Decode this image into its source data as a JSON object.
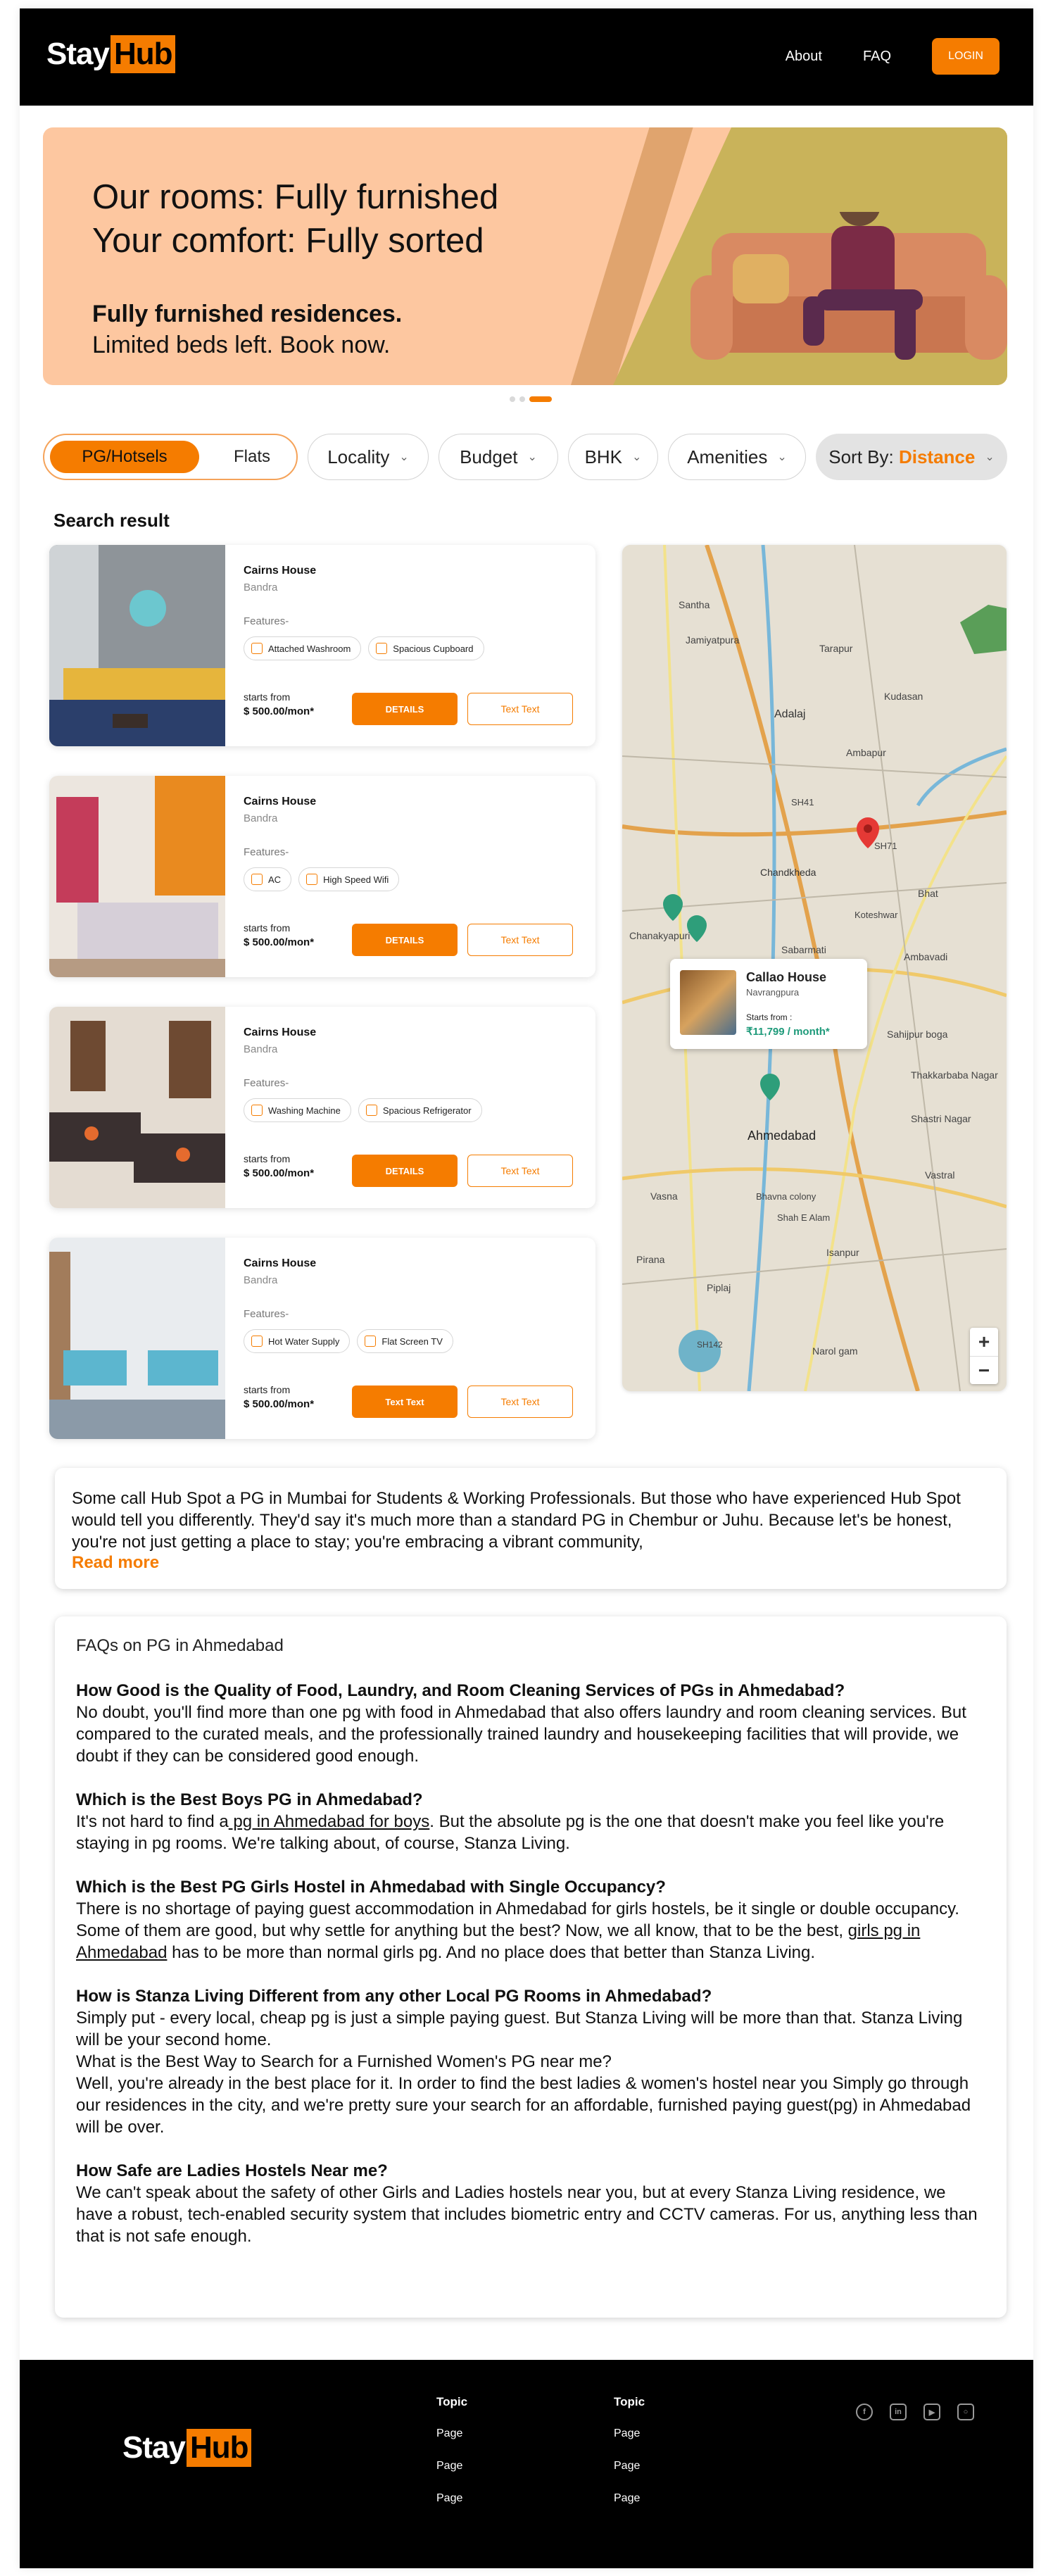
{
  "header": {
    "logo_stay": "Stay",
    "logo_hub": "Hub",
    "nav": [
      "About",
      "FAQ"
    ],
    "login": "LOGIN"
  },
  "hero": {
    "title_line1": "Our rooms: Fully furnished",
    "title_line2": "Your comfort: Fully sorted",
    "sub_bold": "Fully furnished residences.",
    "sub_regular": "Limited beds left. Book now.",
    "slides_total": 3,
    "active_slide": 3
  },
  "filters": {
    "toggle_on": "PG/Hotsels",
    "toggle_off": "Flats",
    "locality": "Locality",
    "budget": "Budget",
    "bhk": "BHK",
    "amenities": "Amenities",
    "sort_prefix": "Sort By:",
    "sort_value": "Distance"
  },
  "search_title": "Search result",
  "listings": [
    {
      "name": "Cairns House",
      "area": "Bandra",
      "features_label": "Features-",
      "features": [
        {
          "label": "Attached Washroom",
          "icon": "washroom-icon"
        },
        {
          "label": "Spacious Cupboard",
          "icon": "cupboard-icon"
        }
      ],
      "starts_from": "starts from",
      "price": "$ 500.00/mon*",
      "primary_btn": "DETAILS",
      "secondary_btn": "Text Text"
    },
    {
      "name": "Cairns House",
      "area": "Bandra",
      "features_label": "Features-",
      "features": [
        {
          "label": "AC",
          "icon": "ac-icon"
        },
        {
          "label": "High Speed Wifi",
          "icon": "wifi-icon"
        }
      ],
      "starts_from": "starts from",
      "price": "$ 500.00/mon*",
      "primary_btn": "DETAILS",
      "secondary_btn": "Text Text"
    },
    {
      "name": "Cairns House",
      "area": "Bandra",
      "features_label": "Features-",
      "features": [
        {
          "label": "Washing Machine",
          "icon": "washing-machine-icon"
        },
        {
          "label": "Spacious Refrigerator",
          "icon": "refrigerator-icon"
        }
      ],
      "starts_from": "starts from",
      "price": "$ 500.00/mon*",
      "primary_btn": "DETAILS",
      "secondary_btn": "Text Text"
    },
    {
      "name": "Cairns House",
      "area": "Bandra",
      "features_label": "Features-",
      "features": [
        {
          "label": "Hot Water Supply",
          "icon": "hot-water-icon"
        },
        {
          "label": "Flat Screen TV",
          "icon": "tv-icon"
        }
      ],
      "starts_from": "starts from",
      "price": "$ 500.00/mon*",
      "primary_btn": "Text Text",
      "secondary_btn": "Text Text"
    }
  ],
  "map": {
    "labels": [
      "Santha",
      "Jamiyatpura",
      "Tarapur",
      "Kudasan",
      "Adalaj",
      "Ambapur",
      "SH41",
      "Chandkheda",
      "SH71",
      "Koteshwar",
      "Bhat",
      "Chanakyapuri",
      "Sabarmati",
      "Ambavadi",
      "Ahmedabad",
      "Sahijpur boga",
      "Thakkarbaba Nagar",
      "Shastri Nagar",
      "Vastral",
      "Vasna",
      "Isanpur",
      "Pirana",
      "Piplaj",
      "SH142",
      "Narol gam",
      "Bhavna colony",
      "Shah E Alam"
    ],
    "popup": {
      "name": "Callao House",
      "area": "Navrangpura",
      "starts_from": "Starts from :",
      "price": "₹11,799 / month*"
    },
    "zoom_in": "+",
    "zoom_out": "−",
    "colors": {
      "pin_red": "#e53935",
      "pin_green": "#2e9e7a"
    }
  },
  "about": {
    "text": "Some call Hub Spot a PG in Mumbai for Students & Working Professionals. But those who have experienced Hub Spot would tell you differently. They'd say it's much more than a standard PG in Chembur or Juhu. Because let's be honest, you're not just getting a place to stay; you're embracing a vibrant community,",
    "read_more": "Read more"
  },
  "faq": {
    "title": "FAQs on PG in Ahmedabad",
    "q1": "How Good is the Quality of Food, Laundry, and Room Cleaning Services of PGs in Ahmedabad?",
    "a1": "No doubt, you'll find more than one pg with food in Ahmedabad that also offers laundry and room cleaning services. But compared to the curated meals, and the professionally trained laundry and housekeeping facilities that  will provide, we doubt if they can be considered good enough.",
    "q2": "Which is the Best Boys PG in Ahmedabad?",
    "a2_pre": "It's not hard to find a",
    "a2_link": " pg in Ahmedabad for boys",
    "a2_post": ". But the absolute pg is the one that doesn't make you feel like you're staying in pg rooms. We're talking about, of course, Stanza Living.",
    "q3": "Which is the Best PG Girls Hostel in Ahmedabad with Single Occupancy?",
    "a3_pre": "There is no shortage of paying guest accommodation in Ahmedabad for girls hostels, be it single or double occupancy. Some of them are good, but why settle for anything but the best? Now, we all know, that to be the best, ",
    "a3_link": "girls pg in Ahmedabad",
    "a3_post": " has to be more than normal girls pg. And no place does that better than Stanza Living.",
    "q4": "How is Stanza Living Different from any other Local PG Rooms in Ahmedabad?",
    "a4a": "Simply put - every local, cheap pg is just a simple paying guest. But Stanza Living will be more than that. Stanza Living will be your second home.",
    "a4b": "What is the Best Way to Search for a Furnished Women's PG near me?",
    "a4c": "Well, you're already in the best place for it. In order to find the best ladies & women's hostel near you Simply go through our residences in the city, and we're pretty sure your search for an affordable, furnished paying guest(pg) in Ahmedabad will be over.",
    "q5": "How Safe are Ladies Hostels Near me?",
    "a5": "We can't speak about the safety of other Girls and Ladies hostels near you, but at every Stanza Living residence, we have a robust, tech-enabled security system that includes biometric entry and CCTV cameras. For us, anything less than that is not safe enough."
  },
  "footer": {
    "logo_stay": "Stay",
    "logo_hub": "Hub",
    "col1_title": "Topic",
    "col1_links": [
      "Page",
      "Page",
      "Page"
    ],
    "col2_title": "Topic",
    "col2_links": [
      "Page",
      "Page",
      "Page"
    ],
    "social": [
      "facebook-icon",
      "linkedin-icon",
      "youtube-icon",
      "instagram-icon"
    ]
  }
}
